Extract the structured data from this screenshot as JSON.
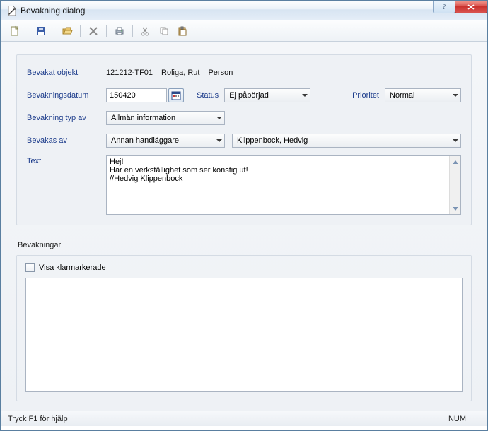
{
  "window": {
    "title": "Bevakning dialog"
  },
  "toolbar": {
    "icons": [
      "new",
      "save",
      "open",
      "delete",
      "print",
      "cut",
      "copy",
      "paste"
    ]
  },
  "form": {
    "labels": {
      "bevakat_objekt": "Bevakat objekt",
      "bevakningsdatum": "Bevakningsdatum",
      "status": "Status",
      "prioritet": "Prioritet",
      "bevakning_typ_av": "Bevakning typ av",
      "bevakas_av": "Bevakas av",
      "text": "Text"
    },
    "bevakat_objekt": {
      "id": "121212-TF01",
      "name": "Roliga, Rut",
      "type": "Person"
    },
    "bevakningsdatum": "150420",
    "status": "Ej påbörjad",
    "prioritet": "Normal",
    "bevakning_typ_av": "Allmän information",
    "bevakas_av_role": "Annan handläggare",
    "bevakas_av_person": "Klippenbock, Hedvig",
    "text": "Hej!\nHar en verkställighet som ser konstig ut!\n//Hedvig Klippenbock"
  },
  "lower": {
    "section_label": "Bevakningar",
    "checkbox_label": "Visa klarmarkerade",
    "checkbox_checked": false
  },
  "statusbar": {
    "help": "Tryck F1 för hjälp",
    "num": "NUM"
  }
}
